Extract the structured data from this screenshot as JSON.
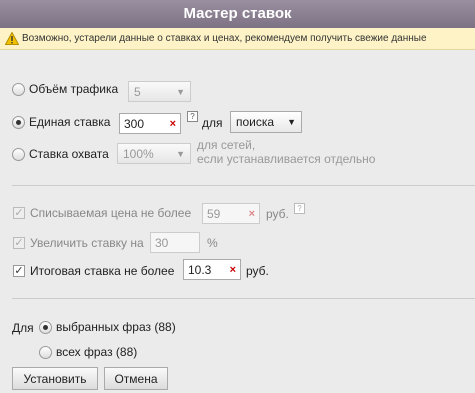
{
  "title": "Мастер ставок",
  "warning": "Возможно, устарели данные о ставках и ценах, рекомендуем получить свежие данные",
  "traffic": {
    "label": "Объём трафика",
    "value": "5"
  },
  "single_bid": {
    "label": "Единая ставка",
    "value": "300",
    "for_label": "для",
    "place_value": "поиска",
    "help": "?"
  },
  "coverage": {
    "label": "Ставка охвата",
    "value": "100%",
    "note_line1": "для сетей,",
    "note_line2": "если устанавливается отдельно"
  },
  "max_price": {
    "label": "Списываемая цена не более",
    "value": "59",
    "unit": "руб.",
    "help": "?"
  },
  "increase": {
    "label": "Увеличить ставку на",
    "value": "30",
    "unit": "%"
  },
  "final_bid": {
    "label": "Итоговая ставка не более",
    "value": "10.3",
    "unit": "руб."
  },
  "scope": {
    "label": "Для",
    "selected": "выбранных фраз (88)",
    "all": "всех фраз (88)"
  },
  "buttons": {
    "apply": "Установить",
    "cancel": "Отмена"
  },
  "icons": {
    "warning": "warning-triangle-icon",
    "clear": "×",
    "check": "✓",
    "arrow": "▼"
  }
}
